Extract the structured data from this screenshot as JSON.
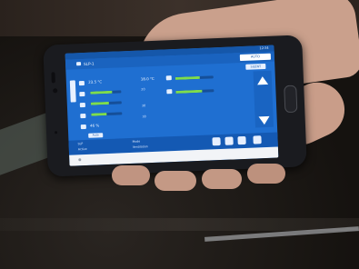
{
  "screen": {
    "title": "SLP-1",
    "mode_label": "AUTO",
    "mode_secondary": "SILENT",
    "time": "12:34"
  },
  "readings": [
    {
      "icon": "thermometer-icon",
      "label": "23.5 °C",
      "level": 0.55
    },
    {
      "icon": "pen-icon",
      "label": "",
      "level": 0.7
    },
    {
      "icon": "heart-icon",
      "label": "",
      "level": 0.6
    },
    {
      "icon": "droplet-icon",
      "label": "46 %",
      "level": 0.5
    }
  ],
  "middle": {
    "value_1": "18.0 °C",
    "value_2": "20",
    "value_3": "30",
    "value_4": "30",
    "level_1": 0.65,
    "level_2": 0.7
  },
  "buttons": {
    "auto": "Auto"
  },
  "bottom": {
    "left_1": "SLP",
    "left_2": "Active",
    "mid_1": "Mode",
    "mid_2": "Ventilation"
  },
  "colors": {
    "screen_bg": "#1f6fd1",
    "bar_fill": "#7fdd4c"
  }
}
